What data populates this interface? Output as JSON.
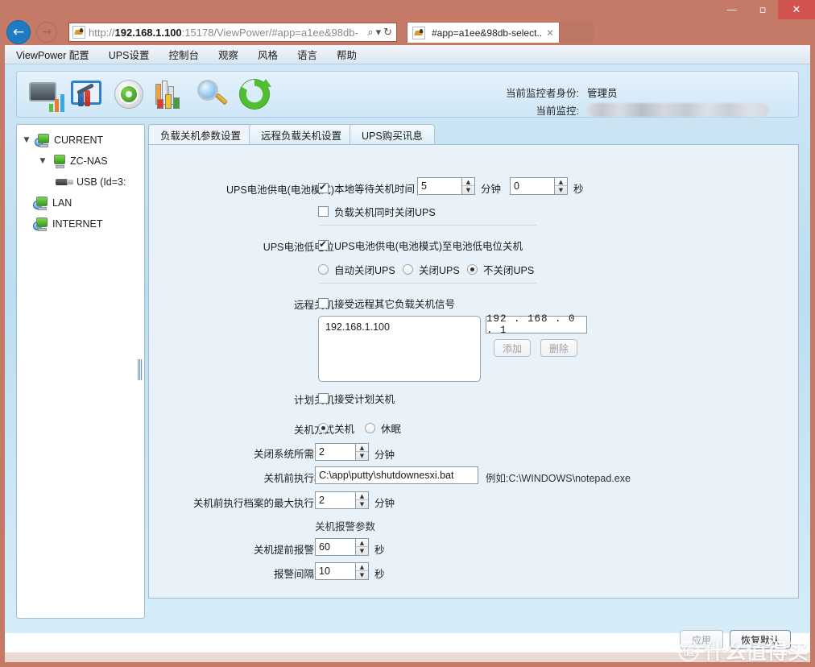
{
  "browser": {
    "window_controls": {
      "minimize": "—",
      "maximize": "▫",
      "close": "✕"
    },
    "back_label": "←",
    "forward_label": "→",
    "url_prefix": "http://",
    "url_host": "192.168.1.100",
    "url_rest": ":15178/ViewPower/#app=a1ee&98db-",
    "search_icon": "⌕",
    "dropdown_icon": "▾",
    "refresh_icon": "↻",
    "tab_title": "#app=a1ee&98db-select...",
    "tab_close": "✕",
    "toolbar_icons": [
      "⌂",
      "★",
      "✿"
    ]
  },
  "menubar": {
    "items": [
      "ViewPower 配置",
      "UPS设置",
      "控制台",
      "观察",
      "风格",
      "语言",
      "帮助"
    ]
  },
  "toolbar": {
    "icons": [
      "monitor-chart-icon",
      "settings-window-icon",
      "gear-icon",
      "books-chart-icon",
      "magnifier-icon",
      "refresh-icon"
    ]
  },
  "userinfo": {
    "role_label": "当前监控者身份:",
    "role_value": "管理员",
    "target_label": "当前监控:",
    "target_value": ""
  },
  "tree": {
    "items": [
      {
        "label": "CURRENT",
        "caret": "▼",
        "icon": "computer-globe-icon",
        "indent": 0
      },
      {
        "label": "ZC-NAS",
        "caret": "▼",
        "icon": "computer-icon",
        "indent": 1
      },
      {
        "label": "USB (Id=3:",
        "caret": "",
        "icon": "usb-icon",
        "indent": 2
      },
      {
        "label": "LAN",
        "caret": "",
        "icon": "computer-globe-icon",
        "indent": 0
      },
      {
        "label": "INTERNET",
        "caret": "",
        "icon": "computer-globe-icon",
        "indent": 0
      }
    ]
  },
  "tabs": [
    {
      "label": "负载关机参数设置",
      "selected": true
    },
    {
      "label": "远程负载关机设置",
      "selected": false
    },
    {
      "label": "UPS购买讯息",
      "selected": false
    }
  ],
  "form": {
    "battery_mode": {
      "label": "UPS电池供电(电池模式)",
      "wait_checkbox_label": "本地等待关机时间",
      "wait_checked": true,
      "minutes_value": "5",
      "minutes_unit": "分钟",
      "seconds_value": "0",
      "seconds_unit": "秒",
      "shutdown_ups_checkbox_label": "负载关机同时关闭UPS",
      "shutdown_ups_checked": false
    },
    "low_battery": {
      "label": "UPS电池低电位",
      "checkbox_label": "UPS电池供电(电池模式)至电池低电位关机",
      "checked": true,
      "radios": [
        {
          "label": "自动关闭UPS",
          "selected": false
        },
        {
          "label": "关闭UPS",
          "selected": false
        },
        {
          "label": "不关闭UPS",
          "selected": true
        }
      ]
    },
    "remote_shutdown": {
      "label": "远程关机",
      "checkbox_label": "接受远程其它负载关机信号",
      "checked": false,
      "list_items": [
        "192.168.1.100"
      ],
      "ip_value": "192 . 168 .  0  .  1",
      "add_button": "添加",
      "delete_button": "删除"
    },
    "scheduled_shutdown": {
      "label": "计划关机",
      "checkbox_label": "接受计划关机",
      "checked": false
    },
    "shutdown_method": {
      "label": "关机方式",
      "radios": [
        {
          "label": "关机",
          "selected": true
        },
        {
          "label": "休眠",
          "selected": false
        }
      ]
    },
    "system_shutdown_time": {
      "label": "关闭系统所需时间",
      "value": "2",
      "unit": "分钟"
    },
    "pre_shutdown_file": {
      "label": "关机前执行档案",
      "value": "C:\\app\\putty\\shutdownesxi.bat",
      "hint": "例如:C:\\WINDOWS\\notepad.exe"
    },
    "pre_shutdown_max_time": {
      "label": "关机前执行档案的最大执行时间",
      "value": "2",
      "unit": "分钟"
    },
    "alarm_section_title": "关机报警参数",
    "alarm_lead_time": {
      "label": "关机提前报警时间",
      "value": "60",
      "unit": "秒"
    },
    "alarm_interval": {
      "label": "报警间隔时间",
      "value": "10",
      "unit": "秒"
    }
  },
  "footer": {
    "apply_label": "应用",
    "apply_enabled": false,
    "reset_label": "恢复默认",
    "reset_enabled": true
  },
  "watermark": {
    "mark": "值",
    "text": "什么值得买"
  }
}
